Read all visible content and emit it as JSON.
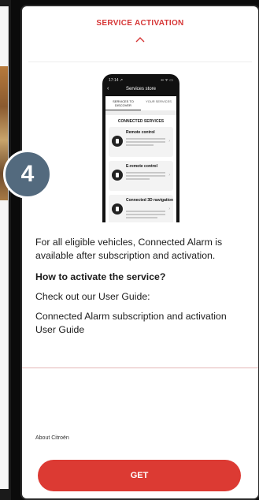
{
  "step_badge": "4",
  "sheet": {
    "title": "SERVICE ACTIVATION"
  },
  "mock_phone": {
    "clock": "17:14 ↗",
    "signal": "▪▪ ᯤ ▭",
    "header": "Services store",
    "tabs": [
      "SERVICES TO DISCOVER",
      "YOUR SERVICES"
    ],
    "section": "CONNECTED SERVICES",
    "items": [
      {
        "name": "Remote control"
      },
      {
        "name": "E-remote control"
      },
      {
        "name": "Connected 3D navigation"
      }
    ]
  },
  "content": {
    "paragraph1": "For all eligible vehicles, Connected Alarm is available after subscription and activation.",
    "heading": "How to activate the service?",
    "paragraph2": "Check out our User Guide:",
    "link": "Connected Alarm subscription and activation User Guide"
  },
  "footer": {
    "about": "About Citroën",
    "button_label": "GET"
  },
  "colors": {
    "accent": "#dc3a33",
    "badge": "#536a7e"
  }
}
